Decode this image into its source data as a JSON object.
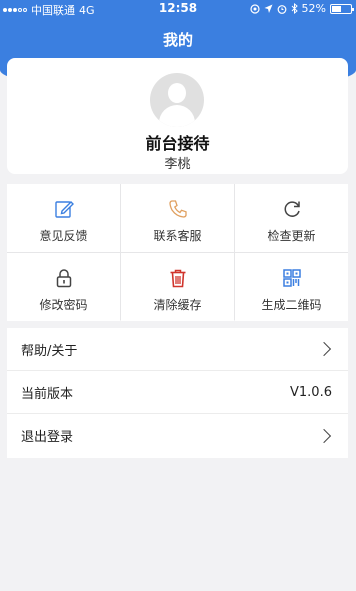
{
  "status_bar": {
    "carrier": "中国联通",
    "network": "4G",
    "time": "12:58",
    "battery_percent": "52%",
    "battery_level": 0.52
  },
  "header": {
    "title": "我的",
    "bg_color": "#3b7fe0"
  },
  "profile": {
    "name": "前台接待",
    "sub_name": "李桃"
  },
  "grid": [
    {
      "label": "意见反馈",
      "icon": "edit-icon",
      "color": "#3b7fe0"
    },
    {
      "label": "联系客服",
      "icon": "phone-icon",
      "color": "#e0a060"
    },
    {
      "label": "检查更新",
      "icon": "refresh-icon",
      "color": "#444444"
    },
    {
      "label": "修改密码",
      "icon": "lock-icon",
      "color": "#444444"
    },
    {
      "label": "清除缓存",
      "icon": "trash-icon",
      "color": "#d0342c"
    },
    {
      "label": "生成二维码",
      "icon": "qrcode-icon",
      "color": "#3b7fe0"
    }
  ],
  "list": {
    "help_label": "帮助/关于",
    "version_label": "当前版本",
    "version_value": "V1.0.6",
    "logout_label": "退出登录"
  }
}
